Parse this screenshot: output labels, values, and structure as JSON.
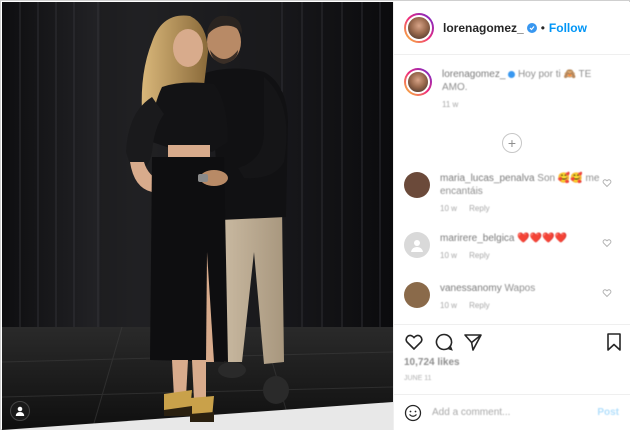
{
  "header": {
    "username": "lorenagomez_",
    "separator": "•",
    "follow_label": "Follow"
  },
  "caption": {
    "username": "lorenagomez_",
    "text": "Hoy por ti 🙈 TE AMO.",
    "time": "11 w"
  },
  "comments": [
    {
      "username": "maria_lucas_penalva",
      "text": "Son 🥰🥰 me encantáis",
      "time": "10 w",
      "reply_label": "Reply",
      "avatar_color": "#6b4a3a"
    },
    {
      "username": "marirere_belgica",
      "text": "❤️❤️❤️❤️",
      "time": "10 w",
      "reply_label": "Reply",
      "avatar_color": "#d9d9d9"
    },
    {
      "username": "vanessanomy",
      "text": "Wapos",
      "time": "10 w",
      "reply_label": "Reply",
      "avatar_color": "#8a6a4a"
    }
  ],
  "actions": {
    "likes": "10,724 likes",
    "date": "JUNE 11"
  },
  "add_comment": {
    "placeholder": "Add a comment...",
    "post_label": "Post"
  },
  "icons": {
    "tag": "person-tag-icon",
    "like": "heart-icon",
    "comment": "comment-icon",
    "share": "share-icon",
    "save": "bookmark-icon",
    "emoji": "emoji-icon",
    "load_more": "plus-circle-icon"
  },
  "colors": {
    "follow_blue": "#0095f6",
    "verified_blue": "#3897f0"
  }
}
